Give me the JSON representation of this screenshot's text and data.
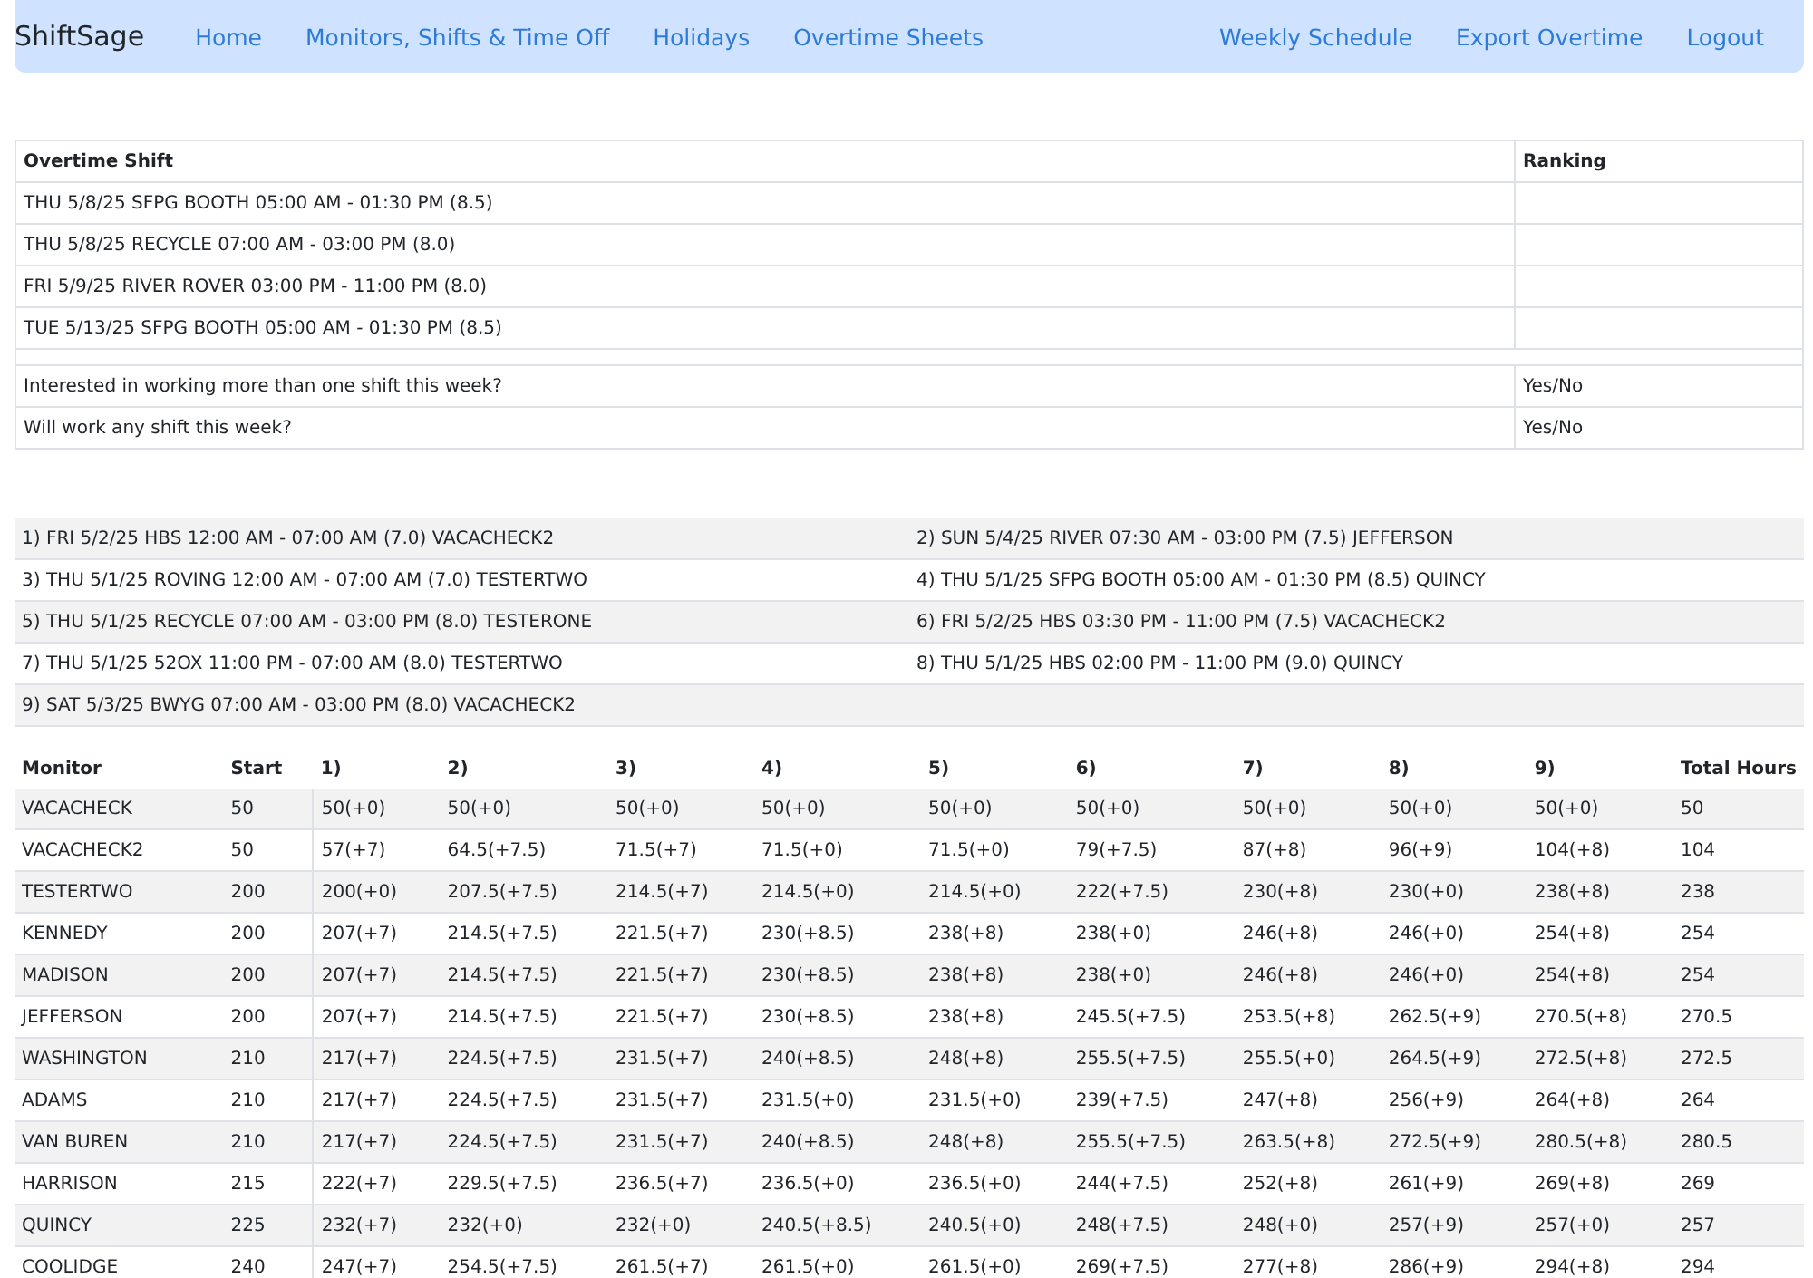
{
  "navbar": {
    "brand": "ShiftSage",
    "left_links": [
      "Home",
      "Monitors, Shifts & Time Off",
      "Holidays",
      "Overtime Sheets"
    ],
    "right_links": [
      "Weekly Schedule",
      "Export Overtime",
      "Logout"
    ]
  },
  "overtime_table": {
    "columns": [
      "Overtime Shift",
      "Ranking"
    ],
    "shifts": [
      "THU 5/8/25 SFPG BOOTH 05:00 AM - 01:30 PM (8.5)",
      "THU 5/8/25 RECYCLE 07:00 AM - 03:00 PM (8.0)",
      "FRI 5/9/25 RIVER ROVER 03:00 PM - 11:00 PM (8.0)",
      "TUE 5/13/25 SFPG BOOTH 05:00 AM - 01:30 PM (8.5)"
    ],
    "questions": [
      {
        "question": "Interested in working more than one shift this week?",
        "answer": "Yes/No"
      },
      {
        "question": "Will work any shift this week?",
        "answer": "Yes/No"
      }
    ]
  },
  "assignments": [
    "1) FRI 5/2/25 HBS 12:00 AM - 07:00 AM (7.0) VACACHECK2",
    "2) SUN 5/4/25 RIVER 07:30 AM - 03:00 PM (7.5) JEFFERSON",
    "3) THU 5/1/25 ROVING 12:00 AM - 07:00 AM (7.0) TESTERTWO",
    "4) THU 5/1/25 SFPG BOOTH 05:00 AM - 01:30 PM (8.5) QUINCY",
    "5) THU 5/1/25 RECYCLE 07:00 AM - 03:00 PM (8.0) TESTERONE",
    "6) FRI 5/2/25 HBS 03:30 PM - 11:00 PM (7.5) VACACHECK2",
    "7) THU 5/1/25 52OX 11:00 PM - 07:00 AM (8.0) TESTERTWO",
    "8) THU 5/1/25 HBS 02:00 PM - 11:00 PM (9.0) QUINCY",
    "9) SAT 5/3/25 BWYG 07:00 AM - 03:00 PM (8.0) VACACHECK2"
  ],
  "hours_table": {
    "columns": [
      "Monitor",
      "Start",
      "1)",
      "2)",
      "3)",
      "4)",
      "5)",
      "6)",
      "7)",
      "8)",
      "9)",
      "Total Hours"
    ],
    "rows": [
      [
        "VACACHECK",
        "50",
        "50(+0)",
        "50(+0)",
        "50(+0)",
        "50(+0)",
        "50(+0)",
        "50(+0)",
        "50(+0)",
        "50(+0)",
        "50(+0)",
        "50"
      ],
      [
        "VACACHECK2",
        "50",
        "57(+7)",
        "64.5(+7.5)",
        "71.5(+7)",
        "71.5(+0)",
        "71.5(+0)",
        "79(+7.5)",
        "87(+8)",
        "96(+9)",
        "104(+8)",
        "104"
      ],
      [
        "TESTERTWO",
        "200",
        "200(+0)",
        "207.5(+7.5)",
        "214.5(+7)",
        "214.5(+0)",
        "214.5(+0)",
        "222(+7.5)",
        "230(+8)",
        "230(+0)",
        "238(+8)",
        "238"
      ],
      [
        "KENNEDY",
        "200",
        "207(+7)",
        "214.5(+7.5)",
        "221.5(+7)",
        "230(+8.5)",
        "238(+8)",
        "238(+0)",
        "246(+8)",
        "246(+0)",
        "254(+8)",
        "254"
      ],
      [
        "MADISON",
        "200",
        "207(+7)",
        "214.5(+7.5)",
        "221.5(+7)",
        "230(+8.5)",
        "238(+8)",
        "238(+0)",
        "246(+8)",
        "246(+0)",
        "254(+8)",
        "254"
      ],
      [
        "JEFFERSON",
        "200",
        "207(+7)",
        "214.5(+7.5)",
        "221.5(+7)",
        "230(+8.5)",
        "238(+8)",
        "245.5(+7.5)",
        "253.5(+8)",
        "262.5(+9)",
        "270.5(+8)",
        "270.5"
      ],
      [
        "WASHINGTON",
        "210",
        "217(+7)",
        "224.5(+7.5)",
        "231.5(+7)",
        "240(+8.5)",
        "248(+8)",
        "255.5(+7.5)",
        "255.5(+0)",
        "264.5(+9)",
        "272.5(+8)",
        "272.5"
      ],
      [
        "ADAMS",
        "210",
        "217(+7)",
        "224.5(+7.5)",
        "231.5(+7)",
        "231.5(+0)",
        "231.5(+0)",
        "239(+7.5)",
        "247(+8)",
        "256(+9)",
        "264(+8)",
        "264"
      ],
      [
        "VAN BUREN",
        "210",
        "217(+7)",
        "224.5(+7.5)",
        "231.5(+7)",
        "240(+8.5)",
        "248(+8)",
        "255.5(+7.5)",
        "263.5(+8)",
        "272.5(+9)",
        "280.5(+8)",
        "280.5"
      ],
      [
        "HARRISON",
        "215",
        "222(+7)",
        "229.5(+7.5)",
        "236.5(+7)",
        "236.5(+0)",
        "236.5(+0)",
        "244(+7.5)",
        "252(+8)",
        "261(+9)",
        "269(+8)",
        "269"
      ],
      [
        "QUINCY",
        "225",
        "232(+7)",
        "232(+0)",
        "232(+0)",
        "240.5(+8.5)",
        "240.5(+0)",
        "248(+7.5)",
        "248(+0)",
        "257(+9)",
        "257(+0)",
        "257"
      ],
      [
        "COOLIDGE",
        "240",
        "247(+7)",
        "254.5(+7.5)",
        "261.5(+7)",
        "261.5(+0)",
        "261.5(+0)",
        "269(+7.5)",
        "277(+8)",
        "286(+9)",
        "294(+8)",
        "294"
      ]
    ]
  }
}
